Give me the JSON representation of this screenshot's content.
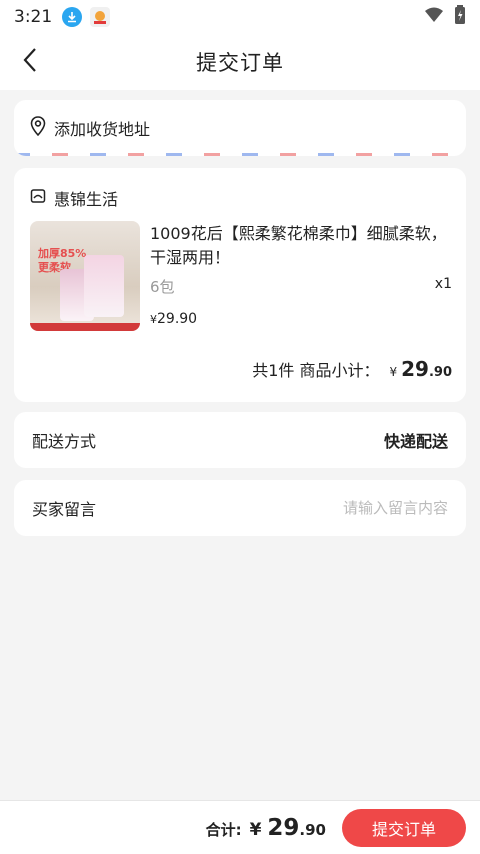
{
  "status_bar": {
    "time": "3:21",
    "icons": [
      "download-icon",
      "app-notification-icon",
      "wifi-icon",
      "battery-icon"
    ]
  },
  "header": {
    "title": "提交订单",
    "back_icon": "chevron-left-icon"
  },
  "address": {
    "label": "添加收货地址",
    "icon": "location-pin-icon"
  },
  "shop": {
    "name": "惠锦生活",
    "icon": "store-icon"
  },
  "product": {
    "title": "1009花后【熙柔繁花棉柔巾】细腻柔软，干湿两用！",
    "spec": "6包",
    "quantity": "x1",
    "price_symbol": "¥",
    "price": "29.90",
    "image_text_top": "加厚85%",
    "image_text_bottom": "更柔软"
  },
  "subtotal": {
    "label": "共1件 商品小计：",
    "symbol": "¥",
    "integer": "29",
    "decimal": ".90"
  },
  "shipping": {
    "label": "配送方式",
    "value": "快递配送"
  },
  "message": {
    "label": "买家留言",
    "placeholder": "请输入留言内容",
    "value": ""
  },
  "footer": {
    "total_label": "合计:",
    "symbol": "¥",
    "integer": "29",
    "decimal": ".90",
    "submit_label": "提交订单"
  },
  "colors": {
    "accent": "#ef4848",
    "background": "#f4f4f4",
    "card": "#ffffff",
    "muted_text": "#999999"
  }
}
